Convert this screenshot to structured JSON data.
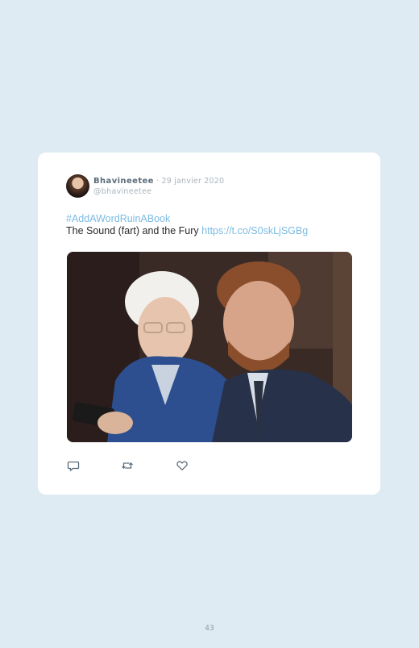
{
  "tweet": {
    "author_name": "Bhavineetee",
    "separator": "·",
    "date": "29 janvier 2020",
    "handle": "@bhavineetee",
    "hashtag": "#AddAWordRuinABook",
    "text": "The Sound (fart) and the Fury",
    "link": "https://t.co/S0skLjSGBg",
    "actions": {
      "reply_icon": "reply-icon",
      "retweet_icon": "retweet-icon",
      "like_icon": "like-icon"
    }
  },
  "page": {
    "number": "43"
  },
  "colors": {
    "background": "#deebf3",
    "card": "#ffffff",
    "link": "#7bbbe3",
    "author": "#5b6d7b",
    "muted": "#a9b4bc"
  }
}
